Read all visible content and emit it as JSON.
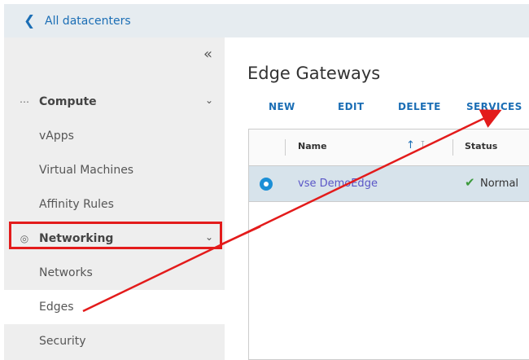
{
  "topbar": {
    "back_icon": "chevron-left-icon",
    "back_label": "All datacenters"
  },
  "sidebar": {
    "collapse_icon": "«",
    "groups": [
      {
        "label": "Compute",
        "icon": "grid-dots-icon",
        "items": [
          "vApps",
          "Virtual Machines",
          "Affinity Rules"
        ]
      },
      {
        "label": "Networking",
        "icon": "network-globe-icon",
        "items": [
          "Networks",
          "Edges",
          "Security"
        ]
      }
    ],
    "active_item": "Edges"
  },
  "main": {
    "title": "Edge Gateways",
    "actions": [
      "NEW",
      "EDIT",
      "DELETE",
      "SERVICES"
    ],
    "grid": {
      "columns": [
        "Name",
        "Status"
      ],
      "rows": [
        {
          "name": "vse DemoEdge",
          "status": "Normal",
          "selected": true
        }
      ]
    }
  },
  "colors": {
    "accent": "#1b6eb5",
    "annotation": "#e31b1b",
    "selected_row": "#d7e3eb",
    "status_ok": "#3c9a3c"
  }
}
